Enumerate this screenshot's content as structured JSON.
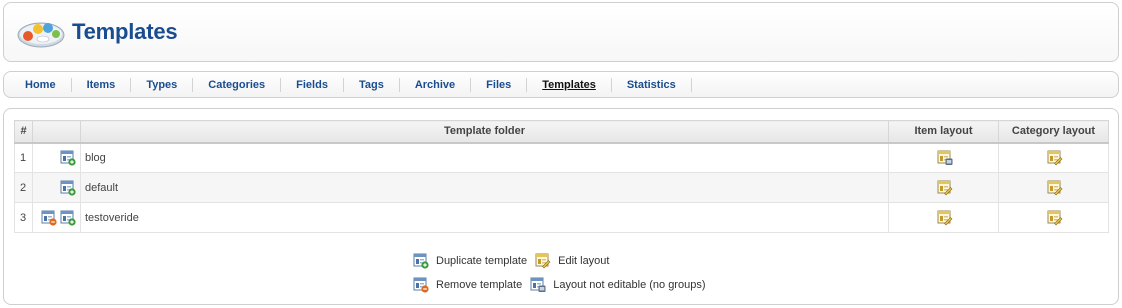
{
  "page": {
    "title": "Templates"
  },
  "menu": {
    "items": [
      {
        "label": "Home"
      },
      {
        "label": "Items"
      },
      {
        "label": "Types"
      },
      {
        "label": "Categories"
      },
      {
        "label": "Fields"
      },
      {
        "label": "Tags"
      },
      {
        "label": "Archive"
      },
      {
        "label": "Files"
      },
      {
        "label": "Templates",
        "active": true
      },
      {
        "label": "Statistics"
      }
    ]
  },
  "table": {
    "headers": {
      "num": "#",
      "folder": "Template folder",
      "item_layout": "Item layout",
      "category_layout": "Category layout"
    },
    "rows": [
      {
        "num": "1",
        "folder": "blog",
        "icons": [
          "duplicate-template-icon"
        ],
        "item_layout": "layout-not-editable-icon",
        "category_layout": "edit-layout-icon"
      },
      {
        "num": "2",
        "folder": "default",
        "icons": [
          "duplicate-template-icon"
        ],
        "item_layout": "edit-layout-icon",
        "category_layout": "edit-layout-icon"
      },
      {
        "num": "3",
        "folder": "testoveride",
        "icons": [
          "remove-template-icon",
          "duplicate-template-icon"
        ],
        "item_layout": "edit-layout-icon",
        "category_layout": "edit-layout-icon"
      }
    ]
  },
  "legend": {
    "duplicate": "Duplicate template",
    "edit": "Edit layout",
    "remove": "Remove template",
    "not_editable": "Layout not editable (no groups)"
  },
  "colors": {
    "title": "#1a4d8f",
    "link": "#1a4d8f",
    "duplicate_badge": "#3a9a3a",
    "remove_badge": "#e06a1c",
    "edit_badge": "#e8c24a"
  }
}
